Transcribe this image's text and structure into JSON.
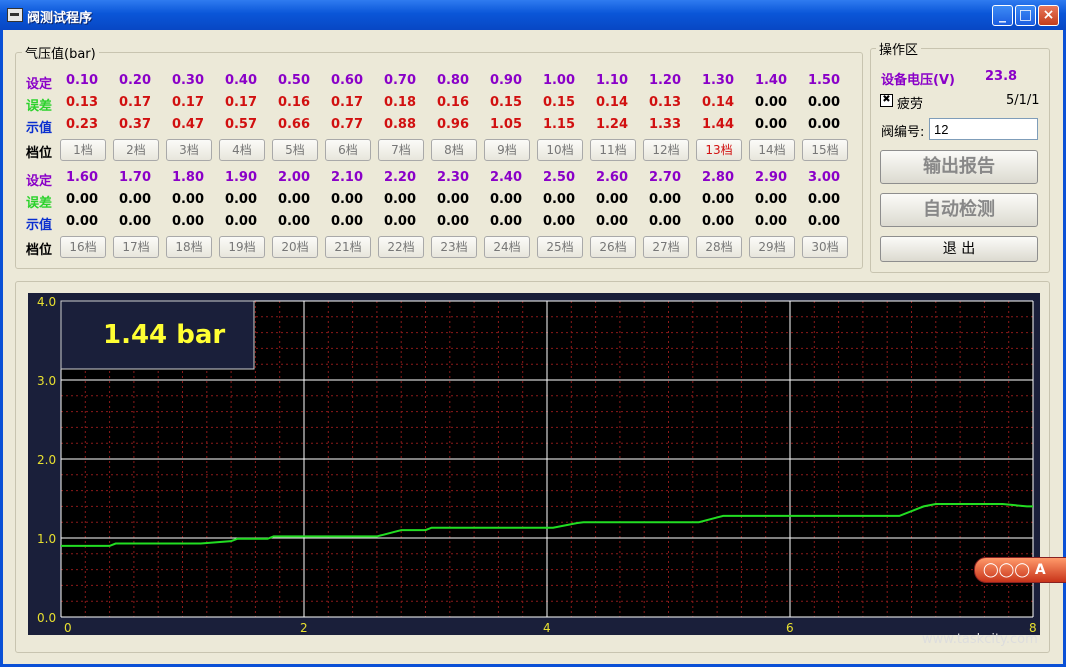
{
  "window": {
    "title": "阀测试程序"
  },
  "pressure_group": {
    "title": "气压值(bar)",
    "row_labels": {
      "set": "设定",
      "error": "误差",
      "display": "示值",
      "gear": "档位"
    },
    "row1": {
      "set": [
        "0.10",
        "0.20",
        "0.30",
        "0.40",
        "0.50",
        "0.60",
        "0.70",
        "0.80",
        "0.90",
        "1.00",
        "1.10",
        "1.20",
        "1.30",
        "1.40",
        "1.50"
      ],
      "error": [
        "0.13",
        "0.17",
        "0.17",
        "0.17",
        "0.16",
        "0.17",
        "0.18",
        "0.16",
        "0.15",
        "0.15",
        "0.14",
        "0.13",
        "0.14",
        "0.00",
        "0.00"
      ],
      "display": [
        "0.23",
        "0.37",
        "0.47",
        "0.57",
        "0.66",
        "0.77",
        "0.88",
        "0.96",
        "1.05",
        "1.15",
        "1.24",
        "1.33",
        "1.44",
        "0.00",
        "0.00"
      ],
      "gears": [
        "1档",
        "2档",
        "3档",
        "4档",
        "5档",
        "6档",
        "7档",
        "8档",
        "9档",
        "10档",
        "11档",
        "12档",
        "13档",
        "14档",
        "15档"
      ]
    },
    "row2": {
      "set": [
        "1.60",
        "1.70",
        "1.80",
        "1.90",
        "2.00",
        "2.10",
        "2.20",
        "2.30",
        "2.40",
        "2.50",
        "2.60",
        "2.70",
        "2.80",
        "2.90",
        "3.00"
      ],
      "error": [
        "0.00",
        "0.00",
        "0.00",
        "0.00",
        "0.00",
        "0.00",
        "0.00",
        "0.00",
        "0.00",
        "0.00",
        "0.00",
        "0.00",
        "0.00",
        "0.00",
        "0.00"
      ],
      "display": [
        "0.00",
        "0.00",
        "0.00",
        "0.00",
        "0.00",
        "0.00",
        "0.00",
        "0.00",
        "0.00",
        "0.00",
        "0.00",
        "0.00",
        "0.00",
        "0.00",
        "0.00"
      ],
      "gears": [
        "16档",
        "17档",
        "18档",
        "19档",
        "20档",
        "21档",
        "22档",
        "23档",
        "24档",
        "25档",
        "26档",
        "27档",
        "28档",
        "29档",
        "30档"
      ]
    },
    "active_gear": "13档"
  },
  "operation": {
    "title": "操作区",
    "voltage_label": "设备电压(V)",
    "voltage_value": "23.8",
    "fatigue_label": "疲劳",
    "fatigue_checked": true,
    "fatigue_count": "5/1/1",
    "valve_label": "阀编号:",
    "valve_value": "12",
    "report_button": "输出报告",
    "auto_button": "自动检测",
    "exit_button": "退 出"
  },
  "chart_data": {
    "type": "line",
    "readout": "1.44 bar",
    "xlim": [
      0,
      8
    ],
    "ylim": [
      0,
      4
    ],
    "x_ticks": [
      "0",
      "2",
      "4",
      "6",
      "8"
    ],
    "y_ticks": [
      "0.0",
      "1.0",
      "2.0",
      "3.0",
      "4.0"
    ],
    "grid": true,
    "colors": {
      "background": "#000000",
      "line": "#22dd22",
      "major_grid": "#ffffff",
      "minor_grid": "#8b1a1a",
      "tick_text": "#e8e030",
      "readout_text": "#ffff33"
    },
    "series": [
      {
        "x": [
          0,
          0.4,
          0.45,
          1.15,
          1.4,
          1.45,
          1.7,
          1.75,
          2.6,
          2.75,
          2.8,
          3.0,
          3.05,
          4.05,
          4.25,
          4.3,
          5.25,
          5.4,
          5.45,
          6.9,
          7.1,
          7.2,
          7.75,
          7.95,
          8.0
        ],
        "y": [
          0.9,
          0.9,
          0.93,
          0.93,
          0.96,
          0.99,
          0.99,
          1.02,
          1.02,
          1.08,
          1.1,
          1.1,
          1.13,
          1.13,
          1.19,
          1.2,
          1.2,
          1.26,
          1.28,
          1.28,
          1.4,
          1.43,
          1.43,
          1.4,
          1.4
        ]
      }
    ]
  },
  "watermark": "www.taskcity.com",
  "badge_text": "A"
}
